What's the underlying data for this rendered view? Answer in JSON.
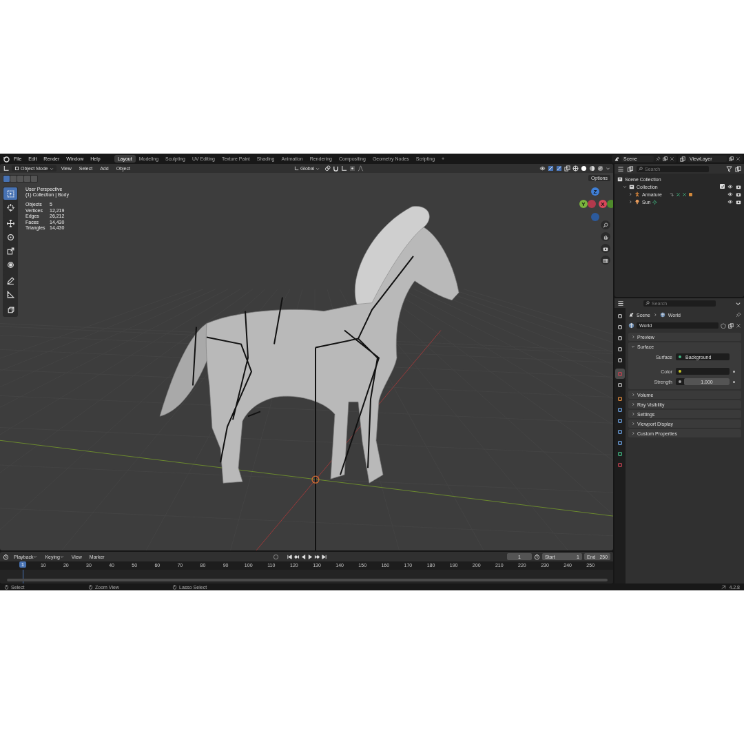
{
  "menu_bar": {
    "menus": [
      "File",
      "Edit",
      "Render",
      "Window",
      "Help"
    ],
    "workspaces": [
      {
        "label": "Layout",
        "selected": true
      },
      {
        "label": "Modeling",
        "selected": false
      },
      {
        "label": "Sculpting",
        "selected": false
      },
      {
        "label": "UV Editing",
        "selected": false
      },
      {
        "label": "Texture Paint",
        "selected": false
      },
      {
        "label": "Shading",
        "selected": false
      },
      {
        "label": "Animation",
        "selected": false
      },
      {
        "label": "Rendering",
        "selected": false
      },
      {
        "label": "Compositing",
        "selected": false
      },
      {
        "label": "Geometry Nodes",
        "selected": false
      },
      {
        "label": "Scripting",
        "selected": false
      }
    ],
    "add_workspace": "+",
    "scene": "Scene",
    "view_layer": "ViewLayer"
  },
  "viewport": {
    "mode": "Object Mode",
    "menus": [
      "View",
      "Select",
      "Add",
      "Object"
    ],
    "orientation": "Global",
    "options": "Options",
    "select_modes": [
      {
        "selected": true
      },
      {
        "selected": false
      },
      {
        "selected": false
      },
      {
        "selected": false
      },
      {
        "selected": false
      }
    ],
    "tools": [
      {
        "kind": "select",
        "selected": true
      },
      {
        "kind": "cursor",
        "selected": false
      },
      {
        "kind": "move",
        "selected": false
      },
      {
        "kind": "rotate",
        "selected": false
      },
      {
        "kind": "scale",
        "selected": false
      },
      {
        "kind": "transform",
        "selected": false
      },
      {
        "kind": "annotate",
        "selected": false
      },
      {
        "kind": "measure",
        "selected": false
      },
      {
        "kind": "add",
        "selected": false
      }
    ],
    "view_name": "User Perspective",
    "collection": "(1) Collection | Body",
    "stats": [
      {
        "label": "Objects",
        "value": "5"
      },
      {
        "label": "Vertices",
        "value": "12,219"
      },
      {
        "label": "Edges",
        "value": "26,212"
      },
      {
        "label": "Faces",
        "value": "14,430"
      },
      {
        "label": "Triangles",
        "value": "14,430"
      }
    ],
    "gizmo": {
      "z": "Z",
      "y": "Y",
      "x": "X"
    }
  },
  "outliner": {
    "search_placeholder": "Search",
    "tree": [
      {
        "label": "Scene Collection",
        "kind": "scene",
        "children": [
          {
            "label": "Collection",
            "kind": "collection",
            "expanded": true,
            "checked": true,
            "children": [
              {
                "label": "Armature",
                "kind": "armature",
                "expanded": false
              },
              {
                "label": "Sun",
                "kind": "light",
                "expanded": false
              }
            ]
          }
        ]
      }
    ]
  },
  "properties": {
    "search_placeholder": "Search",
    "tabs": [
      {
        "selected": false
      },
      {
        "selected": false
      },
      {
        "selected": false
      },
      {
        "selected": false
      },
      {
        "selected": false
      },
      {
        "selected": true
      },
      {
        "selected": false
      },
      {
        "selected": false
      },
      {
        "selected": false
      },
      {
        "selected": false
      },
      {
        "selected": false
      },
      {
        "selected": false
      },
      {
        "selected": false
      },
      {
        "selected": false
      }
    ],
    "breadcrumb": [
      "Scene",
      "World"
    ],
    "world": "World",
    "panels": [
      {
        "label": "Preview",
        "expanded": false
      },
      {
        "label": "Surface",
        "expanded": true,
        "fields": [
          {
            "label": "Surface",
            "value": "Background",
            "kind": "shader"
          },
          {
            "label": "Color",
            "kind": "color"
          },
          {
            "label": "Strength",
            "value": "1.000",
            "kind": "number"
          }
        ]
      },
      {
        "label": "Volume",
        "expanded": false
      },
      {
        "label": "Ray Visibility",
        "expanded": false
      },
      {
        "label": "Settings",
        "expanded": false
      },
      {
        "label": "Viewport Display",
        "expanded": false
      },
      {
        "label": "Custom Properties",
        "expanded": false
      }
    ]
  },
  "timeline": {
    "menus": [
      {
        "label": "Playback",
        "dropdown": true
      },
      {
        "label": "Keying",
        "dropdown": true
      },
      {
        "label": "View",
        "dropdown": false
      },
      {
        "label": "Marker",
        "dropdown": false
      }
    ],
    "current_frame": "1",
    "start_label": "Start",
    "start": "1",
    "end_label": "End",
    "end": "250",
    "playhead_label": "1",
    "ruler": [
      "10",
      "20",
      "30",
      "40",
      "50",
      "60",
      "70",
      "80",
      "90",
      "100",
      "110",
      "120",
      "130",
      "140",
      "150",
      "160",
      "170",
      "180",
      "190",
      "200",
      "210",
      "220",
      "230",
      "240",
      "250"
    ]
  },
  "status_bar": {
    "hints": [
      "Select",
      "Zoom View",
      "Lasso Select"
    ],
    "version": "4.2.8"
  }
}
